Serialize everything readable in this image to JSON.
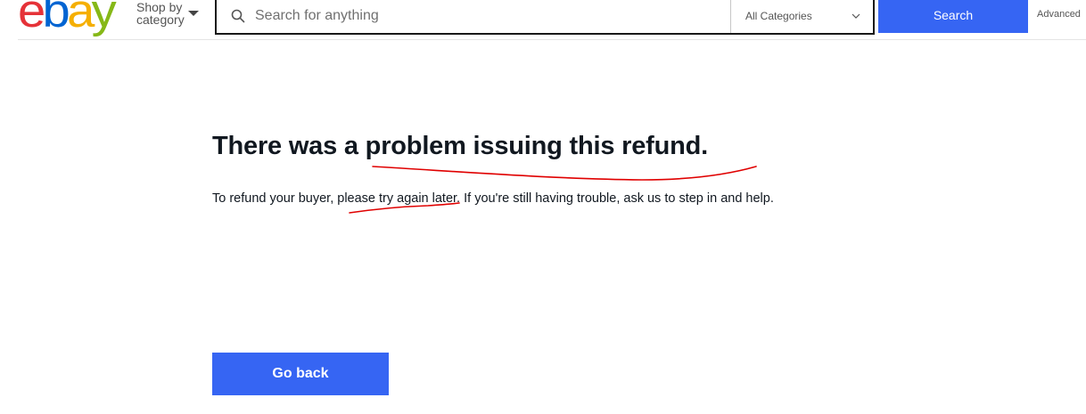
{
  "header": {
    "logo": {
      "letters": [
        "e",
        "b",
        "a",
        "y"
      ],
      "colors": [
        "#e53238",
        "#0064d2",
        "#f5af02",
        "#86b817"
      ]
    },
    "shop_by_category": "Shop by category",
    "search": {
      "placeholder": "Search for anything",
      "value": "",
      "category_selected": "All Categories",
      "button_label": "Search"
    },
    "advanced_label": "Advanced"
  },
  "main": {
    "headline": "There was a problem issuing this refund.",
    "message": "To refund your buyer, please try again later. If you're still having trouble, ask us to step in and help.",
    "go_back_label": "Go back"
  },
  "colors": {
    "accent": "#3665f3",
    "annotation": "#e00000"
  },
  "icons": {
    "search": "search-icon",
    "category_chevron": "chevron-down-icon",
    "shop_caret": "caret-down-icon"
  }
}
